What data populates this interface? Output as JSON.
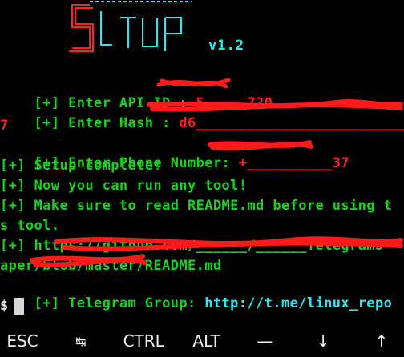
{
  "banner": {
    "logo_text": "SETUP",
    "version": "v1.2"
  },
  "terminal": {
    "lines": [
      {
        "prefix": "[+] Enter API ID : ",
        "value": "5_____720"
      },
      {
        "prefix": "[+] Enter Hash : ",
        "value": "d6_________________________f7b"
      },
      {
        "prefix": "",
        "value": "7"
      },
      {
        "prefix": "[+] Enter Phone Number: ",
        "value": "+__________37"
      },
      {
        "prefix": "[+] Setup complete!",
        "value": ""
      },
      {
        "prefix": "[+] Now you can run any tool!",
        "value": ""
      },
      {
        "prefix": "[+] Make sure to read README.md before using t",
        "value": ""
      },
      {
        "prefix": "s tool.",
        "value": ""
      },
      {
        "prefix": "[+] https://github.com/______/______TelegramS",
        "value": ""
      },
      {
        "prefix": "aper/blob/master/README.md",
        "value": ""
      },
      {
        "prefix": "[+] Telegram Group: ",
        "value": "http://t.me/linux_repo"
      }
    ],
    "prompt": "$"
  },
  "extra_keys": {
    "esc": "ESC",
    "tab": "↹",
    "ctrl": "CTRL",
    "alt": "ALT",
    "dash": "—",
    "down": "↓",
    "up": "↑"
  },
  "colors": {
    "background": "#000000",
    "green": "#16d41a",
    "red": "#ff2020",
    "cyan": "#2ce8f5"
  }
}
